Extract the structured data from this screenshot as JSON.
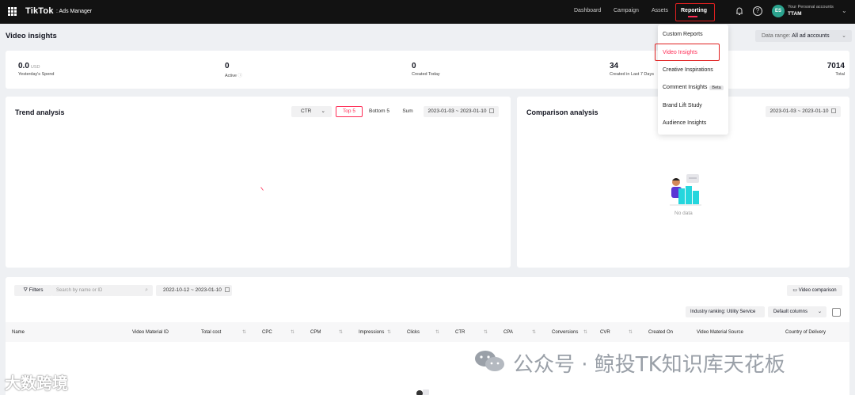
{
  "topbar": {
    "logo": "TikTok",
    "logo_sub": ": Ads Manager",
    "nav": [
      "Dashboard",
      "Campaign",
      "Assets",
      "Reporting"
    ],
    "account_initials": "ES",
    "account_label": "Your Personal accounts",
    "account_name": "TTAM"
  },
  "header": {
    "title": "Video insights",
    "range_label": "Data range:",
    "range_value": "All ad accounts"
  },
  "stats": [
    {
      "value": "0.0",
      "unit": "USD",
      "label": "Yesterday's Spend"
    },
    {
      "value": "0",
      "label": "Active"
    },
    {
      "value": "0",
      "label": "Created Today"
    },
    {
      "value": "34",
      "label": "Created in Last 7 Days"
    },
    {
      "value": "7014",
      "label": "Total"
    }
  ],
  "reporting_menu": [
    "Custom Reports",
    "Video Insights",
    "Creative Inspirations",
    "Comment Insights",
    "Brand Lift Study",
    "Audience Insights"
  ],
  "comment_badge": "Beta",
  "trend": {
    "title": "Trend analysis",
    "metric": "CTR",
    "toggles": [
      "Top 5",
      "Bottom 5",
      "Sum"
    ],
    "date_from": "2023-01-03",
    "date_to": "2023-01-10"
  },
  "comparison": {
    "title": "Comparison analysis",
    "date_from": "2023-01-03",
    "date_to": "2023-01-10",
    "no_data": "No data"
  },
  "table": {
    "filters": "Filters",
    "search_placeholder": "Search by name or ID",
    "date_from": "2022-10-12",
    "date_to": "2023-01-10",
    "video_comparison": "Video comparison",
    "ranking": "Industry ranking: Utility Service",
    "default_columns": "Default columns",
    "columns": [
      "Name",
      "Video Material ID",
      "Total cost",
      "CPC",
      "CPM",
      "Impressions",
      "Clicks",
      "CTR",
      "CPA",
      "Conversions",
      "CVR",
      "Created On",
      "Video Material Source",
      "Country of Delivery"
    ]
  },
  "watermarks": {
    "wechat": "公众号 · 鲸投TK知识库天花板",
    "left": "大数跨境"
  },
  "colors": {
    "accent": "#fe2c55",
    "topbar": "#121212",
    "highlight_box": "#e02020"
  }
}
